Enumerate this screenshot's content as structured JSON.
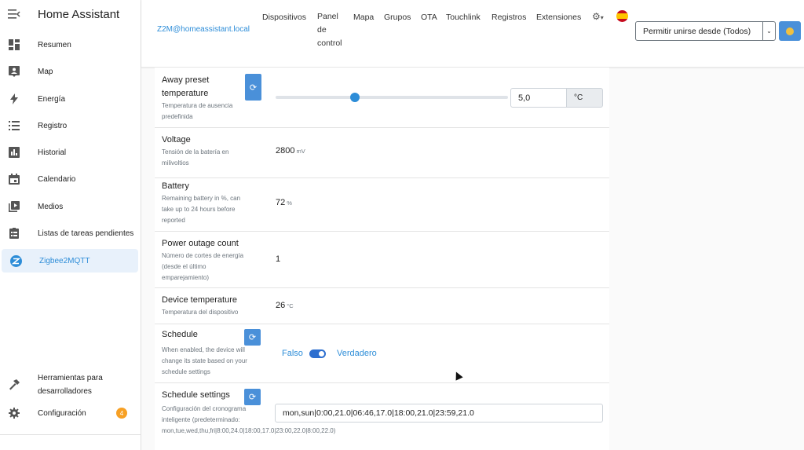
{
  "sidebar": {
    "title": "Home Assistant",
    "items": [
      {
        "label": "Resumen",
        "icon": "dashboard-icon"
      },
      {
        "label": "Map",
        "icon": "map-person-icon"
      },
      {
        "label": "Energía",
        "icon": "lightning-icon"
      },
      {
        "label": "Registro",
        "icon": "list-icon"
      },
      {
        "label": "Historial",
        "icon": "chart-bar-icon"
      },
      {
        "label": "Calendario",
        "icon": "calendar-icon"
      },
      {
        "label": "Medios",
        "icon": "play-box-icon"
      },
      {
        "label": "Listas de tareas pendientes",
        "icon": "clipboard-list-icon"
      },
      {
        "label": "Zigbee2MQTT",
        "icon": "zigbee-icon"
      }
    ],
    "dev_tools_label_1": "Herramientas para",
    "dev_tools_label_2": "desarrolladores",
    "settings_label": "Configuración",
    "settings_badge": "4"
  },
  "topbar": {
    "mqtt_link": "Z2M@homeassistant.local",
    "nav": {
      "devices": "Dispositivos",
      "dashboard_1": "Panel",
      "dashboard_2": "de",
      "dashboard_3": "control",
      "map": "Mapa",
      "groups": "Grupos",
      "ota": "OTA",
      "touchlink": "Touchlink",
      "logs": "Registros",
      "extensions": "Extensiones"
    },
    "permit_join": "Permitir unirse desde (Todos)"
  },
  "rows": {
    "away": {
      "title_1": "Away preset",
      "title_2": "temperature",
      "desc_1": "Temperatura de ausencia",
      "desc_2": "predefinida",
      "slider_fraction": 0.34,
      "value": "5,0",
      "unit": "°C"
    },
    "voltage": {
      "title": "Voltage",
      "desc_1": "Tensión de la batería en",
      "desc_2": "milivoltios",
      "value": "2800",
      "unit": "mV"
    },
    "battery": {
      "title": "Battery",
      "desc_1": "Remaining battery in %, can",
      "desc_2": "take up to 24 hours before",
      "desc_3": "reported",
      "value": "72",
      "unit": "%"
    },
    "outage": {
      "title": "Power outage count",
      "desc_1": "Número de cortes de energía",
      "desc_2": "(desde el último",
      "desc_3": "emparejamiento)",
      "value": "1"
    },
    "devtemp": {
      "title": "Device temperature",
      "desc": "Temperatura del dispositivo",
      "value": "26",
      "unit": "°C"
    },
    "schedule": {
      "title": "Schedule",
      "desc_1": "When enabled, the device will",
      "desc_2": "change its state based on your",
      "desc_3": "schedule settings",
      "false_label": "Falso",
      "true_label": "Verdadero",
      "enabled": true
    },
    "schedule_settings": {
      "title": "Schedule settings",
      "desc_1": "Configuración del cronograma",
      "desc_2": "inteligente (predeterminado:",
      "desc_3": "mon,tue,wed,thu,fri|8:00,24.0|18:00,17.0|23:00,22.0|8:00,22.0)",
      "value": "mon,sun|0:00,21.0|06:46,17.0|18:00,21.0|23:59,21.0"
    }
  },
  "colors": {
    "accent": "#2d8dd8",
    "button": "#4a90d9",
    "badge": "#f7a024"
  }
}
